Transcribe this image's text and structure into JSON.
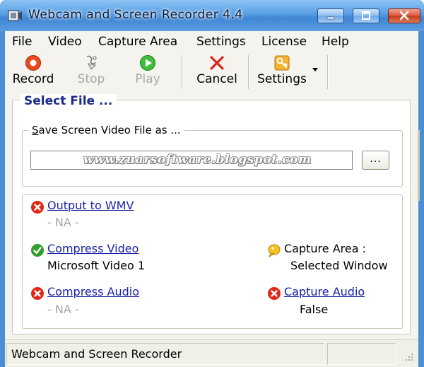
{
  "window": {
    "title": "Webcam and Screen Recorder 4.4",
    "colors": {
      "titlebar": "#4a8fd6",
      "client": "#f4f3ee",
      "link": "#1a20a8",
      "group_title": "#1c2c8c"
    }
  },
  "menu": {
    "items": [
      {
        "label": "File"
      },
      {
        "label": "Video"
      },
      {
        "label": "Capture Area"
      },
      {
        "label": "Settings"
      },
      {
        "label": "License"
      },
      {
        "label": "Help"
      }
    ]
  },
  "toolbar": {
    "record": {
      "label": "Record",
      "icon": "record-icon",
      "enabled": true
    },
    "stop": {
      "label": "Stop",
      "icon": "stop-icon",
      "enabled": false
    },
    "play": {
      "label": "Play",
      "icon": "play-icon",
      "enabled": false
    },
    "cancel": {
      "label": "Cancel",
      "icon": "cancel-icon",
      "enabled": true
    },
    "settings": {
      "label": "Settings",
      "icon": "key-icon",
      "enabled": true
    }
  },
  "select_file": {
    "title": "Select File ...",
    "save_group_title_hotkey": "S",
    "save_group_title_rest": "ave Screen Video File as ...",
    "path_value": "",
    "watermark": "www.zuarsoftware.blogspot.com",
    "browse_label": "..."
  },
  "status": {
    "output": {
      "label": "Output to WMV",
      "state": "error",
      "value": "- NA -"
    },
    "compress_video": {
      "label": "Compress Video",
      "state": "ok",
      "value": "Microsoft Video 1"
    },
    "compress_audio": {
      "label": "Compress Audio",
      "state": "error",
      "value": "- NA -"
    },
    "capture_area": {
      "label": "Capture Area :",
      "state": "info",
      "value": "Selected Window"
    },
    "capture_audio": {
      "label": "Capture Audio",
      "state": "error",
      "value": "False"
    }
  },
  "statusbar": {
    "text": "Webcam and Screen Recorder",
    "pane2": ""
  }
}
